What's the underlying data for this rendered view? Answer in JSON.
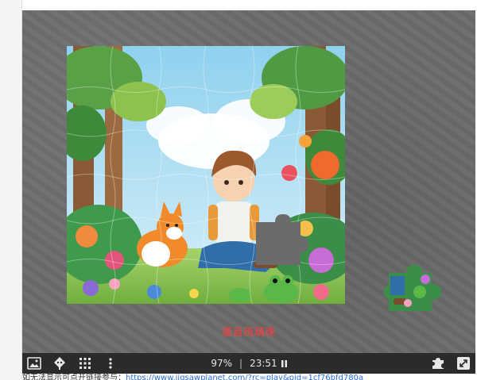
{
  "puzzle": {
    "overlay_text": "墨音琉璃珠",
    "progress_percent": "97%",
    "separator": "|",
    "timer": "23:51"
  },
  "toolbar": {
    "left_icons": [
      "image-icon",
      "ghost-preview-icon",
      "grid-icon",
      "more-vertical-icon"
    ],
    "right_icons": [
      "puzzle-piece-icon",
      "fullscreen-icon"
    ],
    "pause_icon": "pause-icon"
  },
  "footer": {
    "prefix": "如无法显示可点开链接参与：",
    "link": "https://www.jigsawplanet.com/?rc=play&pid=1cf76bfd780a"
  },
  "colors": {
    "stage": "#6b6b6b",
    "toolbar": "#2b2b2b",
    "overlay_text": "#ff3b3b",
    "link": "#2a6dd3"
  }
}
